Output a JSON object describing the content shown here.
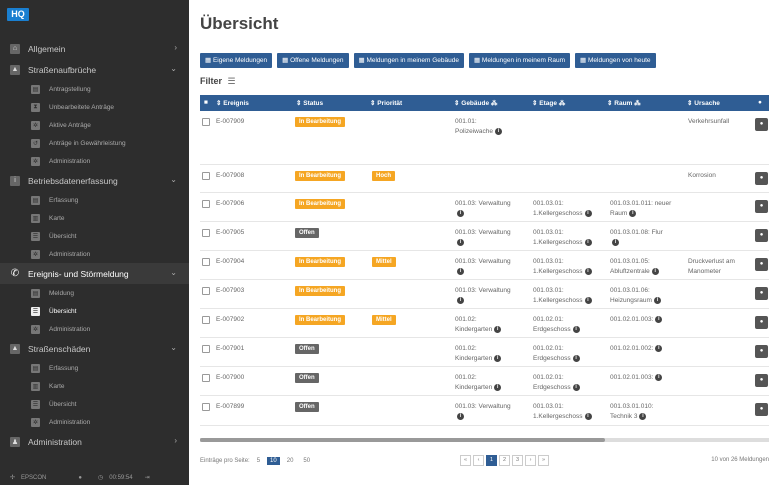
{
  "app": {
    "logo": "HQ"
  },
  "sidebar": {
    "sections": [
      {
        "label": "Allgemein",
        "icon": "home-icon",
        "chevron": "›",
        "items": []
      },
      {
        "label": "Straßenaufbrüche",
        "icon": "road-icon",
        "chevron": "⌄",
        "items": [
          {
            "label": "Antragstellung",
            "icon": "document-icon"
          },
          {
            "label": "Unbearbeitete Anträge",
            "icon": "hourglass-icon"
          },
          {
            "label": "Aktive Anträge",
            "icon": "gear-icon"
          },
          {
            "label": "Anträge in Gewährleistung",
            "icon": "history-icon"
          },
          {
            "label": "Administration",
            "icon": "gear-icon"
          }
        ]
      },
      {
        "label": "Betriebsdatenerfassung",
        "icon": "info-icon",
        "chevron": "⌄",
        "items": [
          {
            "label": "Erfassung",
            "icon": "document-icon"
          },
          {
            "label": "Karte",
            "icon": "chart-icon"
          },
          {
            "label": "Übersicht",
            "icon": "list-icon"
          },
          {
            "label": "Administration",
            "icon": "gear-icon"
          }
        ]
      },
      {
        "label": "Ereignis- und Störmeldung",
        "icon": "phone-icon",
        "chevron": "⌄",
        "active": true,
        "items": [
          {
            "label": "Meldung",
            "icon": "document-icon"
          },
          {
            "label": "Übersicht",
            "icon": "list-icon",
            "active": true
          },
          {
            "label": "Administration",
            "icon": "gear-icon"
          }
        ]
      },
      {
        "label": "Straßenschäden",
        "icon": "road-icon",
        "chevron": "⌄",
        "items": [
          {
            "label": "Erfassung",
            "icon": "document-icon"
          },
          {
            "label": "Karte",
            "icon": "chart-icon"
          },
          {
            "label": "Übersicht",
            "icon": "list-icon"
          },
          {
            "label": "Administration",
            "icon": "gear-icon"
          }
        ]
      },
      {
        "label": "Administration",
        "icon": "users-icon",
        "chevron": "›",
        "items": []
      }
    ],
    "footer": {
      "brand": "EPSCON",
      "time": "00:59:54"
    }
  },
  "page": {
    "title": "Übersicht",
    "filter_label": "Filter"
  },
  "filter_buttons": [
    "Eigene Meldungen",
    "Offene Meldungen",
    "Meldungen in meinem Gebäude",
    "Meldungen in meinem Raum",
    "Meldungen von heute"
  ],
  "table": {
    "columns": [
      "Ereignis",
      "Status",
      "Priorität",
      "Gebäude",
      "Etage",
      "Raum",
      "Ursache"
    ],
    "rows": [
      {
        "id": "E-007909",
        "status": "In Bearbeitung",
        "prio": "",
        "geb": [
          "001.01:",
          "Polizeiwache"
        ],
        "etage": [],
        "raum": [],
        "ursache": [
          "Verkehrsunfall"
        ]
      },
      {
        "id": "E-007908",
        "status": "In Bearbeitung",
        "prio": "Hoch",
        "geb": [],
        "etage": [],
        "raum": [],
        "ursache": [
          "Korrosion"
        ]
      },
      {
        "id": "E-007906",
        "status": "In Bearbeitung",
        "prio": "",
        "geb": [
          "001.03: Verwaltung",
          ""
        ],
        "etage": [
          "001.03.01:",
          "1.Kellergeschoss"
        ],
        "raum": [
          "001.03.01.011: neuer",
          "Raum"
        ],
        "ursache": []
      },
      {
        "id": "E-007905",
        "status": "Offen",
        "prio": "",
        "geb": [
          "001.03: Verwaltung",
          ""
        ],
        "etage": [
          "001.03.01:",
          "1.Kellergeschoss"
        ],
        "raum": [
          "001.03.01.08: Flur",
          ""
        ],
        "ursache": []
      },
      {
        "id": "E-007904",
        "status": "In Bearbeitung",
        "prio": "Mittel",
        "geb": [
          "001.03: Verwaltung",
          ""
        ],
        "etage": [
          "001.03.01:",
          "1.Kellergeschoss"
        ],
        "raum": [
          "001.03.01.05:",
          "Abluftzentrale"
        ],
        "ursache": [
          "Druckverlust am",
          "Manometer"
        ]
      },
      {
        "id": "E-007903",
        "status": "In Bearbeitung",
        "prio": "",
        "geb": [
          "001.03: Verwaltung",
          ""
        ],
        "etage": [
          "001.03.01:",
          "1.Kellergeschoss"
        ],
        "raum": [
          "001.03.01.06:",
          "Heizungsraum"
        ],
        "ursache": []
      },
      {
        "id": "E-007902",
        "status": "In Bearbeitung",
        "prio": "Mittel",
        "geb": [
          "001.02:",
          "Kindergarten"
        ],
        "etage": [
          "001.02.01:",
          "Erdgeschoss"
        ],
        "raum": [
          "001.02.01.003:"
        ],
        "ursache": []
      },
      {
        "id": "E-007901",
        "status": "Offen",
        "prio": "",
        "geb": [
          "001.02:",
          "Kindergarten"
        ],
        "etage": [
          "001.02.01:",
          "Erdgeschoss"
        ],
        "raum": [
          "001.02.01.002:"
        ],
        "ursache": []
      },
      {
        "id": "E-007900",
        "status": "Offen",
        "prio": "",
        "geb": [
          "001.02:",
          "Kindergarten"
        ],
        "etage": [
          "001.02.01:",
          "Erdgeschoss"
        ],
        "raum": [
          "001.02.01.003:"
        ],
        "ursache": []
      },
      {
        "id": "E-007899",
        "status": "Offen",
        "prio": "",
        "geb": [
          "001.03: Verwaltung",
          ""
        ],
        "etage": [
          "001.03.01:",
          "1.Kellergeschoss"
        ],
        "raum": [
          "001.03.01.010:",
          "Technik 3"
        ],
        "ursache": []
      }
    ]
  },
  "footer": {
    "per_page_label": "Einträge pro Seite:",
    "per_page_options": [
      "5",
      "10",
      "20",
      "50"
    ],
    "per_page_selected": "10",
    "pages": [
      "«",
      "‹",
      "1",
      "2",
      "3",
      "›",
      "»"
    ],
    "current_page": "1",
    "count": "10 von 26 Meldungen"
  },
  "colors": {
    "accent": "#2f5d94",
    "orange": "#f5a623",
    "sidebar": "#2d2d2d",
    "logo": "#1a7fd0"
  }
}
